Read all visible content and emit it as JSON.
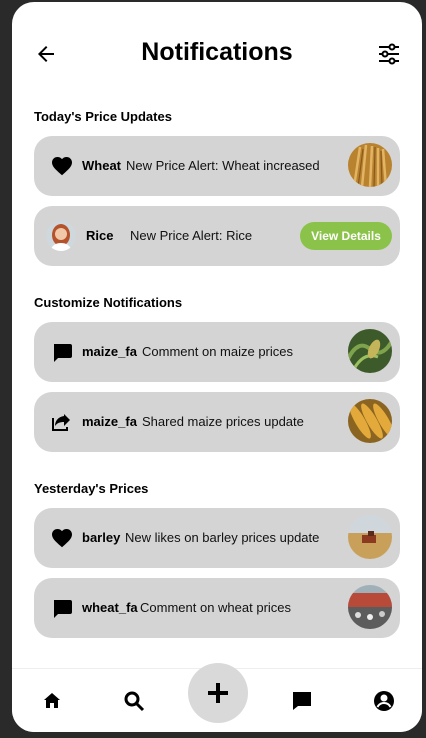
{
  "header": {
    "title": "Notifications",
    "back_icon": "arrow-left-icon",
    "filter_icon": "sliders-icon"
  },
  "sections": [
    {
      "title": "Today's Price Updates",
      "items": [
        {
          "icon": "heart-icon",
          "user": "Wheat",
          "message": "New Price Alert: Wheat increased",
          "thumb": "wheat-image"
        },
        {
          "icon": "avatar",
          "user": "Rice",
          "message": "New Price Alert: Rice",
          "button": "View Details"
        }
      ]
    },
    {
      "title": "Customize Notifications",
      "items": [
        {
          "icon": "comment-icon",
          "user": "maize_fa",
          "message": "Comment on maize prices",
          "thumb": "maize-field-image"
        },
        {
          "icon": "share-icon",
          "user": "maize_fa",
          "message": "Shared maize prices update",
          "thumb": "maize-cobs-image"
        }
      ]
    },
    {
      "title": "Yesterday's Prices",
      "items": [
        {
          "icon": "heart-icon",
          "user": "barley",
          "message": "New likes on barley prices update",
          "thumb": "barley-harvest-image"
        },
        {
          "icon": "comment-icon",
          "user": "wheat_fa",
          "message": "Comment on wheat prices",
          "thumb": "market-image"
        }
      ]
    }
  ],
  "bottom_nav": {
    "items": [
      "home-icon",
      "search-icon",
      "plus-icon",
      "chat-icon",
      "profile-icon"
    ]
  },
  "colors": {
    "card_bg": "#d4d4d4",
    "accent_green": "#8bc34a"
  }
}
